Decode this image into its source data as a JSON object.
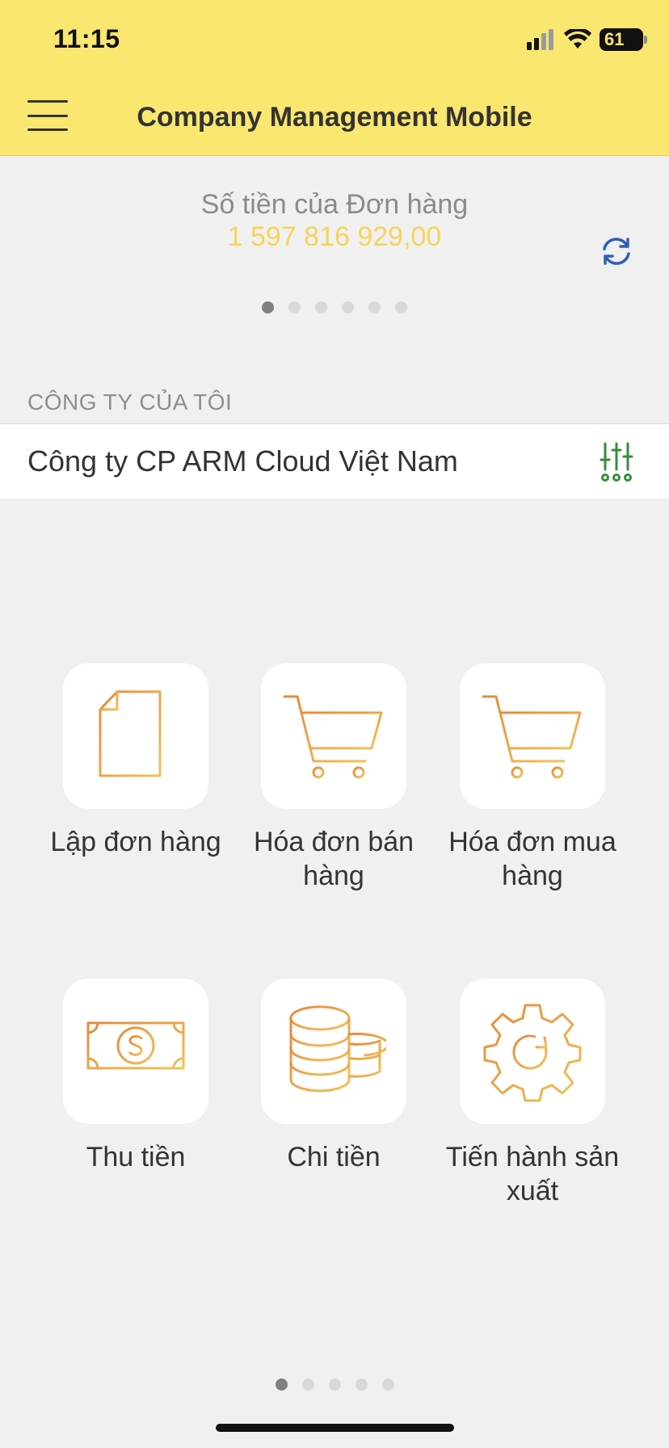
{
  "status": {
    "time": "11:15",
    "battery": "61"
  },
  "header": {
    "title": "Company Management Mobile"
  },
  "summary": {
    "label": "Số tiền của Đơn hàng",
    "value": "1 597 816 929,00",
    "pages": 6,
    "active_page": 0
  },
  "company": {
    "section_label": "CÔNG TY CỦA TÔI",
    "name": "Công ty CP ARM Cloud Việt Nam"
  },
  "grid": [
    {
      "label": "Lập đơn hàng",
      "icon": "document-icon"
    },
    {
      "label": "Hóa đơn bán hàng",
      "icon": "cart-icon"
    },
    {
      "label": "Hóa đơn mua hàng",
      "icon": "cart-icon"
    },
    {
      "label": "Thu tiền",
      "icon": "cash-icon"
    },
    {
      "label": "Chi tiền",
      "icon": "coins-icon"
    },
    {
      "label": "Tiến hành sản xuất",
      "icon": "gear-icon"
    }
  ],
  "grid_pager": {
    "pages": 5,
    "active_page": 0
  },
  "colors": {
    "header_bg": "#f9e76f",
    "amount": "#f7d35a",
    "icon_gradient": [
      "#e58a3a",
      "#f3c15a"
    ],
    "accent_blue": "#2f5fb3",
    "accent_green": "#3a8a3f"
  }
}
